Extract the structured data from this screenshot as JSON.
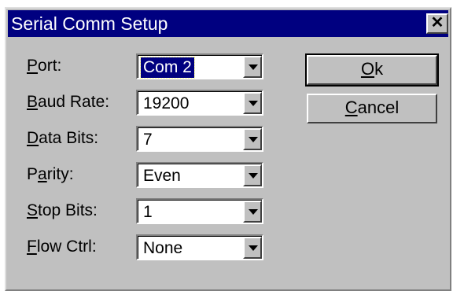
{
  "window": {
    "title": "Serial Comm Setup",
    "close_glyph": "✕"
  },
  "fields": [
    {
      "label": "Port:",
      "mnemonic": "P",
      "rest": "ort:",
      "value": "Com 2"
    },
    {
      "label": "Baud Rate:",
      "mnemonic": "B",
      "rest": "aud Rate:",
      "value": "19200"
    },
    {
      "label": "Data Bits:",
      "mnemonic": "D",
      "rest": "ata Bits:",
      "value": "7"
    },
    {
      "label": "Parity:",
      "pre": "P",
      "mnemonic": "a",
      "rest": "rity:",
      "value": "Even"
    },
    {
      "label": "Stop Bits:",
      "mnemonic": "S",
      "rest": "top Bits:",
      "value": "1"
    },
    {
      "label": "Flow Ctrl:",
      "mnemonic": "F",
      "rest": "low Ctrl:",
      "value": "None"
    }
  ],
  "buttons": {
    "ok": {
      "mnemonic": "O",
      "rest": "k"
    },
    "cancel": {
      "mnemonic": "C",
      "rest": "ancel"
    }
  },
  "colors": {
    "titlebar": "#000080",
    "face": "#c0c0c0",
    "selection": "#000080"
  }
}
